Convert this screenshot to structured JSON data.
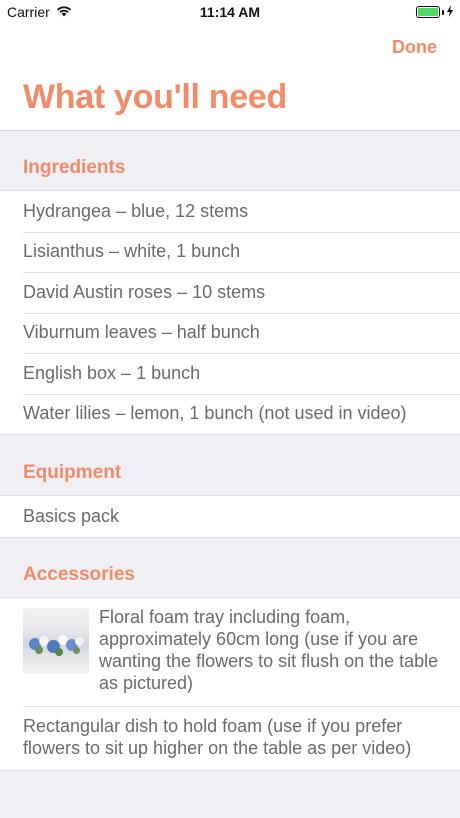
{
  "status": {
    "carrier": "Carrier",
    "time": "11:14 AM"
  },
  "nav": {
    "done_label": "Done",
    "title": "What you'll need"
  },
  "sections": {
    "ingredients": {
      "header": "Ingredients",
      "items": [
        "Hydrangea – blue, 12 stems",
        "Lisianthus – white, 1 bunch",
        "David Austin roses – 10 stems",
        "Viburnum leaves – half bunch",
        "English box – 1 bunch",
        "Water lilies – lemon, 1 bunch (not used in video)"
      ]
    },
    "equipment": {
      "header": "Equipment",
      "items": [
        "Basics pack"
      ]
    },
    "accessories": {
      "header": "Accessories",
      "items": [
        "Floral foam tray including foam, approximately 60cm long (use if you are wanting the flowers to sit flush on the table as pictured)",
        "Rectangular dish to hold foam (use if you prefer flowers to sit up higher on the table as per video)"
      ]
    }
  },
  "colors": {
    "accent": "#f28b68",
    "background": "#f0eff4",
    "text": "#6b6b6b",
    "battery": "#4cd964"
  },
  "icons": [
    "wifi-icon",
    "battery-icon",
    "charging-bolt-icon"
  ]
}
